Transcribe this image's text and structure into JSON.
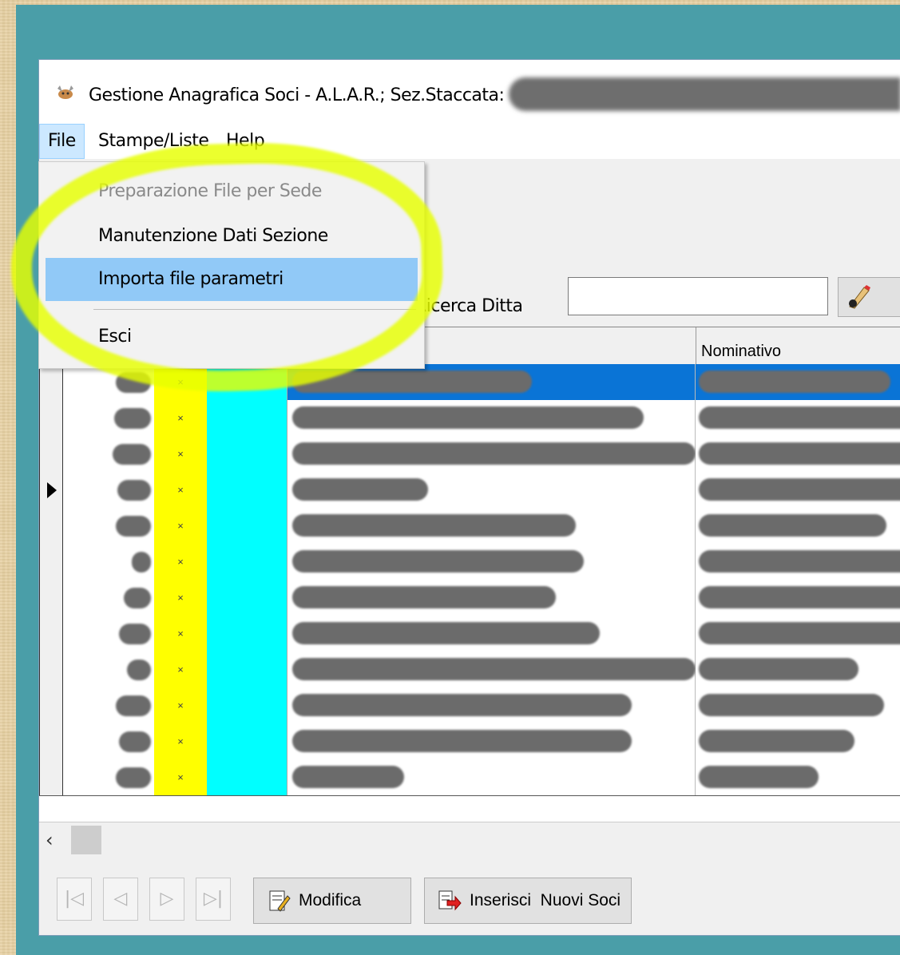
{
  "window": {
    "title": "Gestione Anagrafica Soci - A.L.A.R.; Sez.Staccata:"
  },
  "menubar": {
    "items": [
      "File",
      "Stampe/Liste",
      "Help"
    ]
  },
  "file_menu": {
    "items": [
      {
        "label": "Preparazione File per Sede",
        "state": "disabled"
      },
      {
        "label": "Manutenzione Dati Sezione",
        "state": "normal"
      },
      {
        "label": "Importa file parametri",
        "state": "hover"
      },
      {
        "label": "Esci",
        "state": "normal"
      }
    ]
  },
  "search": {
    "label": "Ricerca Ditta",
    "value": ""
  },
  "grid": {
    "columns": [
      "",
      "Nominativo"
    ],
    "row_flag": "×",
    "row_count": 12,
    "selected_row": 0,
    "current_row": 3
  },
  "buttons": {
    "first": "|◁",
    "prev": "◁",
    "next": "▷",
    "last": "▷|",
    "modifica": "Modifica",
    "inserisci": "Inserisci  Nuovi Soci"
  },
  "colors": {
    "desktop": "#4a9ea8",
    "highlight": "#e6ff00",
    "flag_column": "#ffff00",
    "cyan_column": "#00ffff",
    "selection": "#0a74d6",
    "menu_hover": "#91c9f7"
  }
}
